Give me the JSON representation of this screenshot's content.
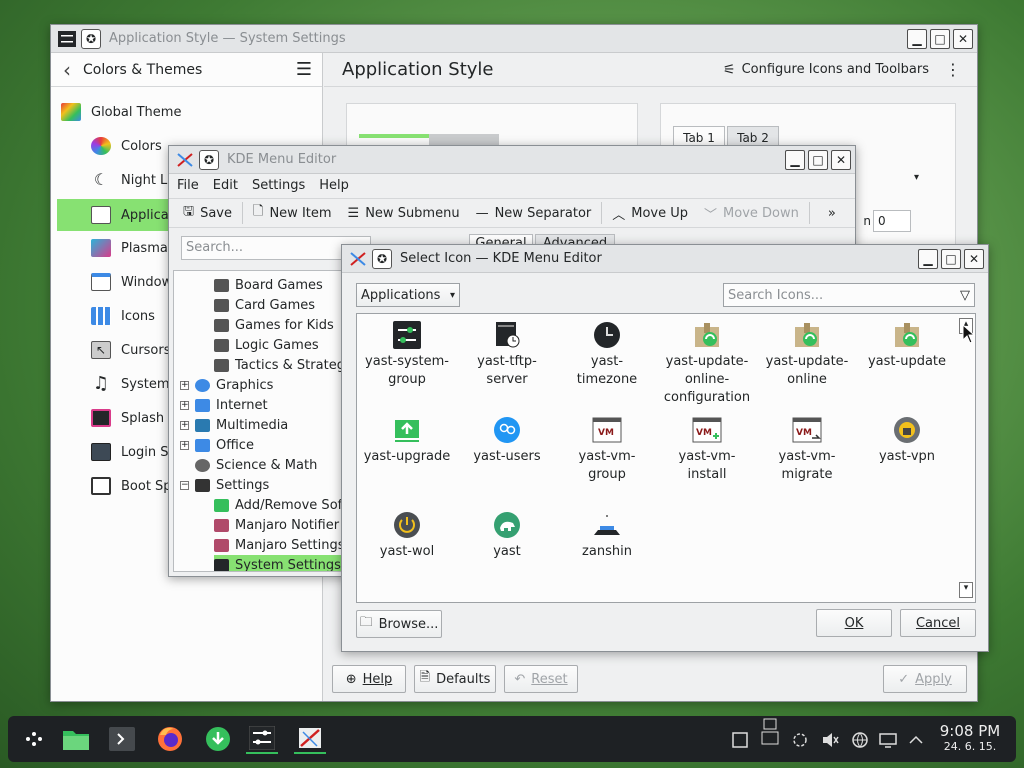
{
  "system_settings": {
    "title": "Application Style — System Settings",
    "sidebar_header": "Colors & Themes",
    "page_title": "Application Style",
    "configure_label": "Configure Icons and Toolbars",
    "sidebar_items": [
      {
        "label": "Global Theme"
      },
      {
        "label": "Colors"
      },
      {
        "label": "Night Li"
      },
      {
        "label": "Applicat"
      },
      {
        "label": "Plasma"
      },
      {
        "label": "Window"
      },
      {
        "label": "Icons"
      },
      {
        "label": "Cursors"
      },
      {
        "label": "System"
      },
      {
        "label": "Splash S"
      },
      {
        "label": "Login Sc"
      },
      {
        "label": "Boot Sp"
      }
    ],
    "tab1": "Tab 1",
    "tab2": "Tab 2",
    "spin_value": "0",
    "spin_label": "n",
    "help_label": "Help",
    "defaults_label": "Defaults",
    "reset_label": "Reset",
    "apply_label": "Apply"
  },
  "menu_editor": {
    "title": "KDE Menu Editor",
    "menus": [
      "File",
      "Edit",
      "Settings",
      "Help"
    ],
    "toolbar": {
      "save": "Save",
      "new_item": "New Item",
      "new_submenu": "New Submenu",
      "new_separator": "New Separator",
      "move_up": "Move Up",
      "move_down": "Move Down",
      "more": "»"
    },
    "search_placeholder": "Search...",
    "tab_general": "General",
    "tab_advanced": "Advanced",
    "tree": [
      {
        "label": "Board Games",
        "level": 2,
        "expander": ""
      },
      {
        "label": "Card Games",
        "level": 2,
        "expander": ""
      },
      {
        "label": "Games for Kids",
        "level": 2,
        "expander": ""
      },
      {
        "label": "Logic Games",
        "level": 2,
        "expander": ""
      },
      {
        "label": "Tactics & Strategy",
        "level": 2,
        "expander": ""
      },
      {
        "label": "Graphics",
        "level": 1,
        "expander": "+"
      },
      {
        "label": "Internet",
        "level": 1,
        "expander": "+"
      },
      {
        "label": "Multimedia",
        "level": 1,
        "expander": "+"
      },
      {
        "label": "Office",
        "level": 1,
        "expander": "+"
      },
      {
        "label": "Science & Math",
        "level": 1,
        "expander": ""
      },
      {
        "label": "Settings",
        "level": 1,
        "expander": "−"
      },
      {
        "label": "Add/Remove Soft",
        "level": 2,
        "expander": ""
      },
      {
        "label": "Manjaro Notifier",
        "level": 2,
        "expander": ""
      },
      {
        "label": "Manjaro Settings",
        "level": 2,
        "expander": ""
      },
      {
        "label": "System Settings (",
        "level": 2,
        "expander": "",
        "selected": true
      }
    ]
  },
  "select_icon": {
    "title": "Select Icon — KDE Menu Editor",
    "context_value": "Applications",
    "search_placeholder": "Search Icons...",
    "icons": [
      {
        "label": "yast-system-group",
        "icon": "settings-sliders-icon"
      },
      {
        "label": "yast-tftp-server",
        "icon": "server-clock-icon"
      },
      {
        "label": "yast-timezone",
        "icon": "clock-icon"
      },
      {
        "label": "yast-update-online-configuration",
        "icon": "package-update-icon"
      },
      {
        "label": "yast-update-online",
        "icon": "package-update-icon"
      },
      {
        "label": "yast-update",
        "icon": "package-update-icon"
      },
      {
        "label": "yast-upgrade",
        "icon": "upgrade-arrow-icon"
      },
      {
        "label": "yast-users",
        "icon": "users-icon"
      },
      {
        "label": "yast-vm-group",
        "icon": "vm-icon"
      },
      {
        "label": "yast-vm-install",
        "icon": "vm-install-icon"
      },
      {
        "label": "yast-vm-migrate",
        "icon": "vm-migrate-icon"
      },
      {
        "label": "yast-vpn",
        "icon": "vpn-globe-icon"
      },
      {
        "label": "yast-wol",
        "icon": "power-icon"
      },
      {
        "label": "yast",
        "icon": "chameleon-icon"
      },
      {
        "label": "zanshin",
        "icon": "laptop-icon"
      }
    ],
    "browse_label": "Browse...",
    "ok_label": "OK",
    "cancel_label": "Cancel"
  },
  "taskbar": {
    "time": "9:08 PM",
    "date": "24. 6. 15."
  },
  "colors": {
    "selection": "#87e172",
    "accent": "#35bf5c"
  }
}
